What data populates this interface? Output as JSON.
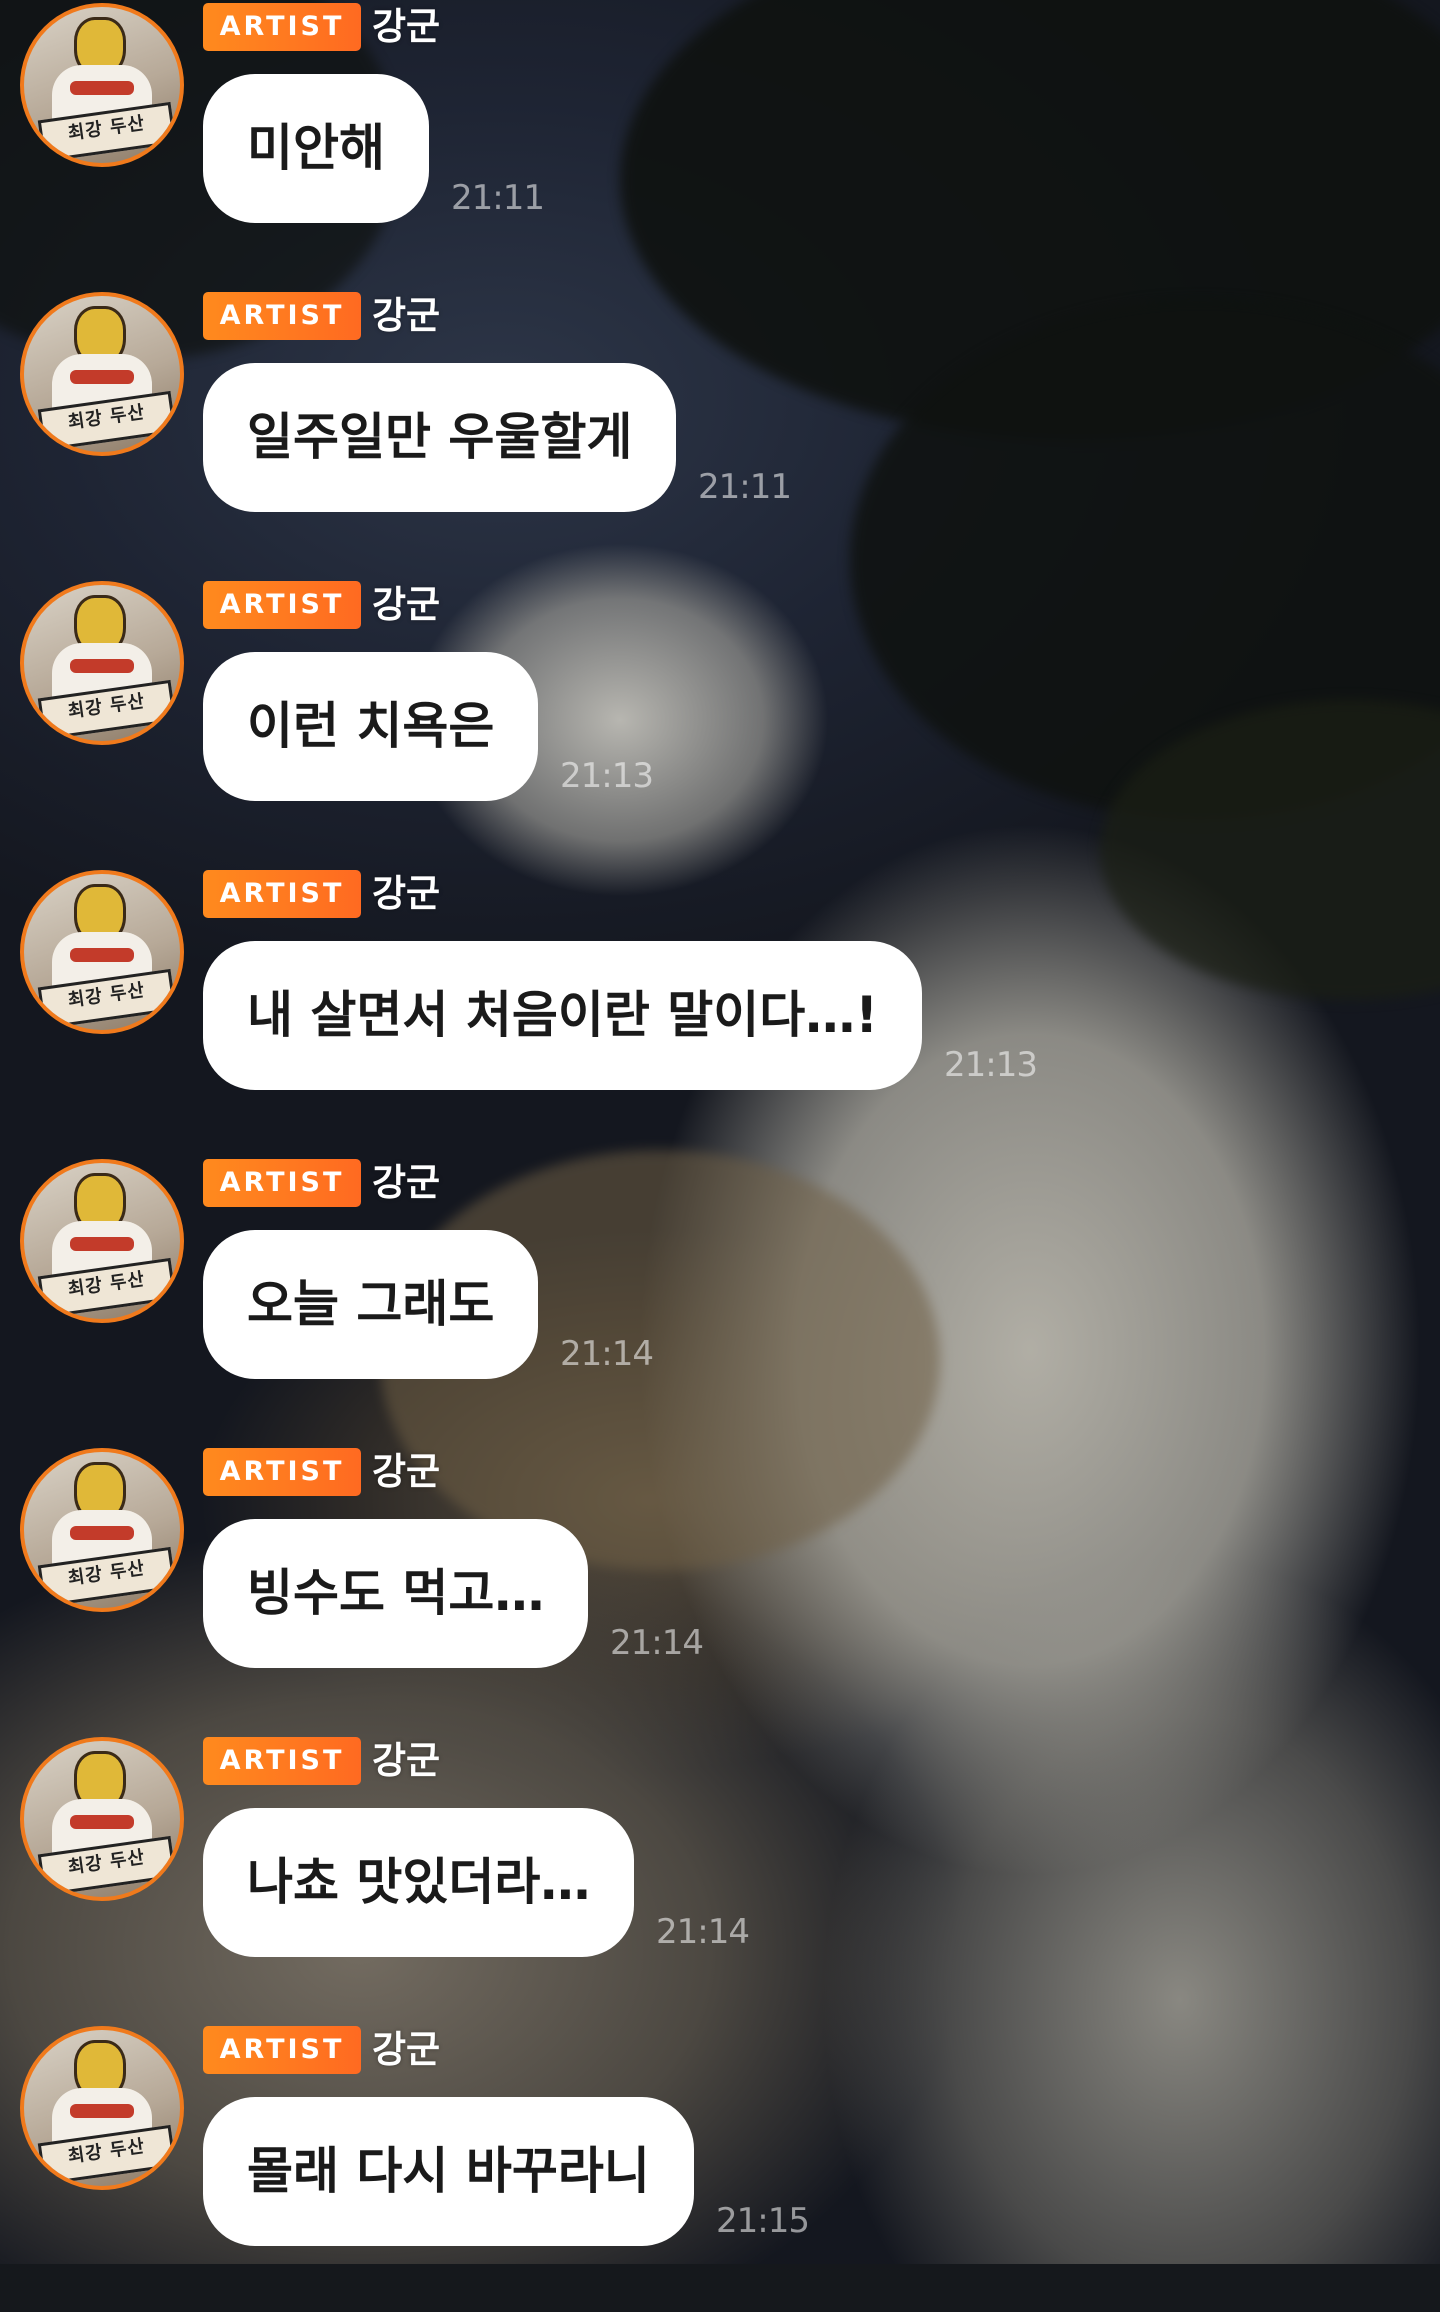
{
  "chat": {
    "messages": [
      {
        "badge": "ARTIST",
        "sender": "강군",
        "text": "미안해",
        "time": "21:11",
        "avatar_sign": "최강 두산"
      },
      {
        "badge": "ARTIST",
        "sender": "강군",
        "text": "일주일만 우울할게",
        "time": "21:11",
        "avatar_sign": "최강 두산"
      },
      {
        "badge": "ARTIST",
        "sender": "강군",
        "text": "이런 치욕은",
        "time": "21:13",
        "avatar_sign": "최강 두산"
      },
      {
        "badge": "ARTIST",
        "sender": "강군",
        "text": "내 살면서 처음이란 말이다…!",
        "time": "21:13",
        "avatar_sign": "최강 두산"
      },
      {
        "badge": "ARTIST",
        "sender": "강군",
        "text": "오늘 그래도",
        "time": "21:14",
        "avatar_sign": "최강 두산"
      },
      {
        "badge": "ARTIST",
        "sender": "강군",
        "text": "빙수도 먹고…",
        "time": "21:14",
        "avatar_sign": "최강 두산"
      },
      {
        "badge": "ARTIST",
        "sender": "강군",
        "text": "나쵸 맛있더라…",
        "time": "21:14",
        "avatar_sign": "최강 두산"
      },
      {
        "badge": "ARTIST",
        "sender": "강군",
        "text": "몰래 다시 바꾸라니",
        "time": "21:15",
        "avatar_sign": "최강 두산"
      }
    ]
  },
  "colors": {
    "badge": "#ff7a1f",
    "avatar_ring": "#f07a1c",
    "bubble": "#ffffff",
    "bubble_text": "#1a1a1a",
    "timestamp": "#ffffff8c"
  }
}
